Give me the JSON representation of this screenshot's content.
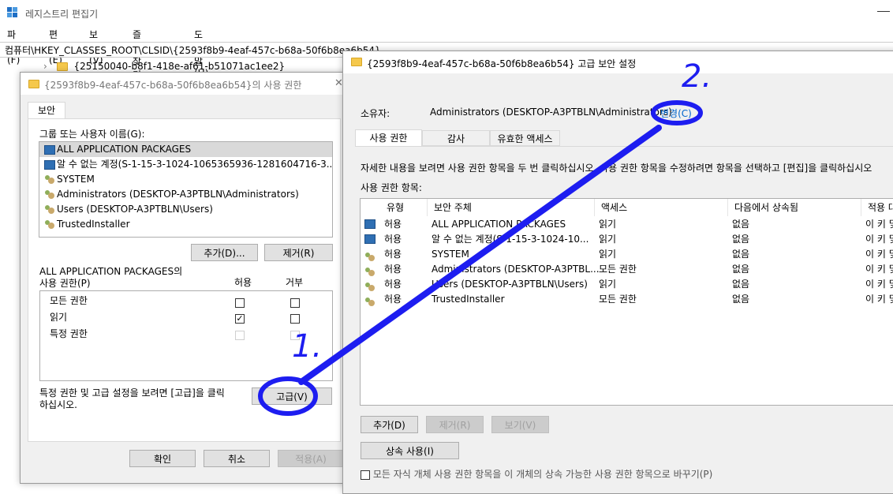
{
  "regedit": {
    "title": "레지스트리 편집기",
    "menu": [
      "파일(F)",
      "편집(E)",
      "보기(V)",
      "즐겨찾기(A)",
      "도움말(H)"
    ],
    "address": "컴퓨터\\HKEY_CLASSES_ROOT\\CLSID\\{2593f8b9-4eaf-457c-b68a-50f6b8ea6b54}",
    "tree_item": "{25150040-b8f1-418e-af61-b51071ac1ee2}"
  },
  "perm_dialog": {
    "title": "{2593f8b9-4eaf-457c-b68a-50f6b8ea6b54}의 사용 권한",
    "tab": "보안",
    "group_label": "그룹 또는 사용자 이름(G):",
    "users": [
      {
        "name": "ALL APPLICATION PACKAGES",
        "icon": "package-icon"
      },
      {
        "name": "알 수 없는 계정(S-1-15-3-1024-1065365936-1281604716-3...",
        "icon": "package-icon"
      },
      {
        "name": "SYSTEM",
        "icon": "users-icon"
      },
      {
        "name": "Administrators (DESKTOP-A3PTBLN\\Administrators)",
        "icon": "users-icon"
      },
      {
        "name": "Users (DESKTOP-A3PTBLN\\Users)",
        "icon": "users-icon"
      },
      {
        "name": "TrustedInstaller",
        "icon": "users-icon"
      }
    ],
    "add_button": "추가(D)...",
    "remove_button": "제거(R)",
    "perm_for_line1": "ALL APPLICATION PACKAGES의",
    "perm_for_line2": "사용 권한(P)",
    "allow_header": "허용",
    "deny_header": "거부",
    "permissions": [
      {
        "name": "모든 권한",
        "allow": "",
        "deny": ""
      },
      {
        "name": "읽기",
        "allow": "✓",
        "deny": ""
      },
      {
        "name": "특정 권한",
        "allow": "",
        "deny": ""
      }
    ],
    "advanced_text_line1": "특정 권한 및 고급 설정을 보려면 [고급]을 클릭",
    "advanced_text_line2": "하십시오.",
    "advanced_button": "고급(V)",
    "ok_button": "확인",
    "cancel_button": "취소",
    "apply_button": "적용(A)"
  },
  "adv_dialog": {
    "title": "{2593f8b9-4eaf-457c-b68a-50f6b8ea6b54} 고급 보안 설정",
    "owner_label": "소유자:",
    "owner_value": "Administrators (DESKTOP-A3PTBLN\\Administrators)",
    "change_link": "변경(C)",
    "tabs": [
      "사용 권한",
      "감사",
      "유효한 액세스"
    ],
    "info_text": "자세한 내용을 보려면 사용 권한 항목을 두 번 클릭하십시오. 사용 권한 항목을 수정하려면 항목을 선택하고 [편집]을 클릭하십시오",
    "entries_label": "사용 권한 항목:",
    "columns": [
      "유형",
      "보안 주체",
      "액세스",
      "다음에서 상속됨",
      "적용 대상"
    ],
    "rows": [
      {
        "type": "허용",
        "principal": "ALL APPLICATION PACKAGES",
        "access": "읽기",
        "inherited": "없음",
        "applies": "이 키 및",
        "icon": "package-icon"
      },
      {
        "type": "허용",
        "principal": "알 수 없는 계정(S-1-15-3-1024-10...",
        "access": "읽기",
        "inherited": "없음",
        "applies": "이 키 및",
        "icon": "package-icon"
      },
      {
        "type": "허용",
        "principal": "SYSTEM",
        "access": "읽기",
        "inherited": "없음",
        "applies": "이 키 및",
        "icon": "users-icon"
      },
      {
        "type": "허용",
        "principal": "Administrators (DESKTOP-A3PTBL...",
        "access": "모든 권한",
        "inherited": "없음",
        "applies": "이 키 및",
        "icon": "users-icon"
      },
      {
        "type": "허용",
        "principal": "Users (DESKTOP-A3PTBLN\\Users)",
        "access": "읽기",
        "inherited": "없음",
        "applies": "이 키 및",
        "icon": "users-icon"
      },
      {
        "type": "허용",
        "principal": "TrustedInstaller",
        "access": "모든 권한",
        "inherited": "없음",
        "applies": "이 키 및",
        "icon": "users-icon"
      }
    ],
    "add_button": "추가(D)",
    "remove_button": "제거(R)",
    "view_button": "보기(V)",
    "inherit_button": "상속 사용(I)",
    "bottom_checkbox_text": "모든 자식 개체 사용 권한 항목을 이 개체의 상속 가능한 사용 권한 항목으로 바꾸기(P)"
  },
  "annotations": {
    "label1": "1.",
    "label2": "2.",
    "color": "#1d1df0"
  }
}
